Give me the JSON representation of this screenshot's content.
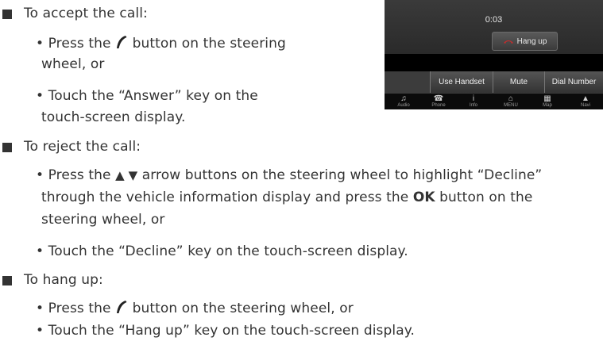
{
  "colors": {
    "text": "#333333",
    "screen_bg": "#000000"
  },
  "display": {
    "timer": "0:03",
    "hang_up_label": "Hang up",
    "keys": [
      "Use Handset",
      "Mute",
      "Dial Number"
    ],
    "bottom_bar": [
      {
        "icon": "music-note-icon",
        "glyph": "♫",
        "label": "Audio"
      },
      {
        "icon": "phone-icon",
        "glyph": "☎",
        "label": "Phone"
      },
      {
        "icon": "info-icon",
        "glyph": "i",
        "label": "Info"
      },
      {
        "icon": "home-icon",
        "glyph": "⌂",
        "label": "MENU"
      },
      {
        "icon": "map-icon",
        "glyph": "▦",
        "label": "Map"
      },
      {
        "icon": "navigation-icon",
        "glyph": "▲",
        "label": "Navi"
      }
    ]
  },
  "accept": {
    "heading": "To accept the call:",
    "b1_pre": "• Press the ",
    "b1_post": " button on the steering",
    "b1_cont": "wheel, or",
    "b2_line1": "• Touch the “Answer” key on the",
    "b2_line2": "touch-screen display."
  },
  "reject": {
    "heading": "To reject the call:",
    "b1_pre": "• Press the ",
    "arrows": "▲ ▼",
    "b1_post": " arrow buttons on the steering wheel to highlight “Decline”",
    "b1_line2_pre": "through the vehicle information display and press the ",
    "b1_ok": "OK",
    "b1_line2_post": " button on the",
    "b1_line3": "steering wheel, or",
    "b2": "• Touch the “Decline” key on the touch-screen display."
  },
  "hangup": {
    "heading": "To hang up:",
    "b1_pre": "• Press the ",
    "b1_post": " button on the steering wheel, or",
    "b2": "• Touch the “Hang up” key on the touch-screen display."
  }
}
